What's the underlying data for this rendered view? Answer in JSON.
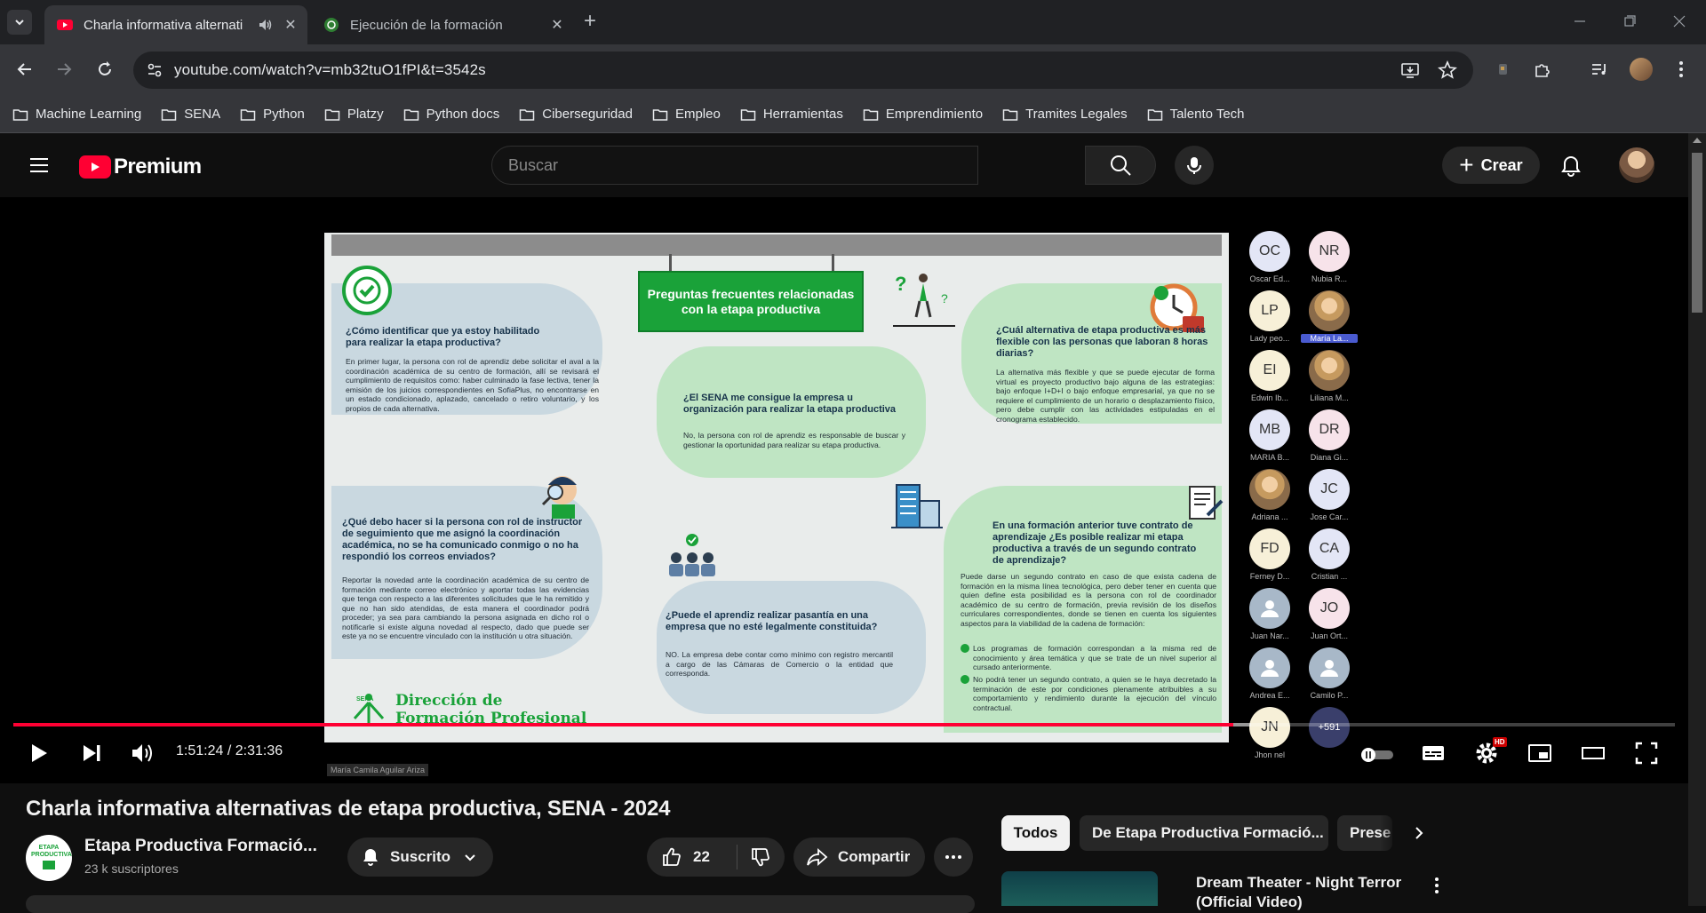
{
  "browser": {
    "tabs": [
      {
        "title": "Charla informativa alternati",
        "active": true
      },
      {
        "title": "Ejecución de la formación",
        "active": false
      }
    ],
    "url": "youtube.com/watch?v=mb32tuO1fPI&t=3542s",
    "bookmarks": [
      "Machine Learning",
      "SENA",
      "Python",
      "Platzy",
      "Python docs",
      "Ciberseguridad",
      "Empleo",
      "Herramientas",
      "Emprendimiento",
      "Tramites Legales",
      "Talento Tech"
    ]
  },
  "youtube": {
    "logo_label": "Premium",
    "search_placeholder": "Buscar",
    "create_label": "Crear"
  },
  "slide": {
    "title": "Preguntas frecuentes relacionadas con la etapa productiva",
    "q1": "¿Cómo identificar que ya estoy habilitado para realizar la etapa productiva?",
    "a1": "En primer lugar, la persona con rol de aprendiz debe solicitar el aval a la coordinación académica de su centro de formación, allí se revisará el cumplimiento de requisitos como: haber culminado la fase lectiva, tener la emisión de los juicios correspondientes en SofiaPlus, no encontrarse en un estado condicionado, aplazado, cancelado o retiro voluntario, y los propios de cada alternativa.",
    "q2": "¿El SENA me consigue la empresa u organización para realizar la etapa productiva",
    "a2": "No, la persona con rol de aprendiz es responsable de buscar y gestionar la oportunidad para realizar su etapa productiva.",
    "q3": "¿Cuál alternativa de etapa productiva es más flexible con las personas que laboran 8 horas diarias?",
    "a3": "La alternativa más flexible y que se puede ejecutar de forma virtual es proyecto productivo bajo alguna de las estrategias: bajo enfoque I+D+I o bajo enfoque empresarial, ya que no se requiere el cumplimiento de un horario o desplazamiento físico, pero debe cumplir con las actividades estipuladas en el cronograma establecido.",
    "q4": "¿Qué debo hacer si la persona con rol de instructor de seguimiento que me asignó la coordinación académica, no se ha comunicado conmigo o no ha respondió los correos enviados?",
    "a4": "Reportar la novedad ante la coordinación académica de su centro de formación mediante correo electrónico y aportar todas las evidencias que tenga con respecto a las diferentes solicitudes que le ha remitido y que no han sido atendidas, de esta manera el coordinador podrá proceder; ya sea para cambiando la persona asignada en dicho rol o notificarle si existe alguna novedad al respecto, dado que puede ser este ya no se encuentre vinculado con la institución u otra situación.",
    "q5": "¿Puede el aprendiz realizar pasantía en una empresa que no esté legalmente constituida?",
    "a5": "NO. La empresa debe contar como mínimo con registro mercantil a cargo de las Cámaras de Comercio o la entidad que corresponda.",
    "q6": "En una formación anterior tuve contrato de aprendizaje ¿Es posible realizar mi etapa productiva a través de un segundo contrato de aprendizaje?",
    "a6": "Puede darse un segundo contrato en caso de que exista cadena de formación en la misma línea tecnológica, pero deber tener en cuenta que quien define esta posibilidad es la persona con rol de coordinador académico de su centro de formación, previa revisión de los diseños curriculares correspondientes, donde se tienen en cuenta los siguientes aspectos para la viabilidad de la cadena de formación:",
    "a6_b1": "Los programas de formación correspondan a la misma red de conocimiento y área temática y que se trate de un nivel superior al cursado anteriormente.",
    "a6_b2": "No podrá tener un segundo contrato, a quien se le haya decretado la terminación de este por condiciones plenamente atribuibles a su comportamiento y rendimiento durante la ejecución del vínculo contractual.",
    "brand_line1": "Dirección de",
    "brand_line2": "Formación Profesional",
    "brand_logo": "SENA"
  },
  "participants": [
    {
      "initials": "OC",
      "name": "Oscar Ed...",
      "color": "#e3e6f6"
    },
    {
      "initials": "NR",
      "name": "Nubia R...",
      "color": "#f7e3ea"
    },
    {
      "initials": "LP",
      "name": "Lady peo...",
      "color": "#f7f0d8"
    },
    {
      "initials": "",
      "name": "María La...",
      "color": "",
      "photo": true,
      "highlight": true
    },
    {
      "initials": "EI",
      "name": "Edwin Ib...",
      "color": "#f7f0d8"
    },
    {
      "initials": "",
      "name": "Liliana M...",
      "color": "",
      "photo": true
    },
    {
      "initials": "MB",
      "name": "MARIA B...",
      "color": "#e3e6f6"
    },
    {
      "initials": "DR",
      "name": "Diana Gi...",
      "color": "#f7e3ea"
    },
    {
      "initials": "",
      "name": "Adriana ...",
      "color": "",
      "photo": true
    },
    {
      "initials": "JC",
      "name": "Jose Car...",
      "color": "#e3e6f6"
    },
    {
      "initials": "FD",
      "name": "Ferney D...",
      "color": "#f7f0d8"
    },
    {
      "initials": "CA",
      "name": "Cristian ...",
      "color": "#e3e6f6"
    },
    {
      "initials": "",
      "name": "Juan Nar...",
      "color": "#a8b8c8",
      "generic": true
    },
    {
      "initials": "JO",
      "name": "Juan Ort...",
      "color": "#f7e3ea"
    },
    {
      "initials": "",
      "name": "Andrea E...",
      "color": "#a8b8c8",
      "generic": true
    },
    {
      "initials": "",
      "name": "Camilo P...",
      "color": "#a8b8c8",
      "generic": true
    },
    {
      "initials": "JN",
      "name": "Jhon nel",
      "color": "#f7f0d8"
    },
    {
      "initials": "+591",
      "name": "",
      "color": "#3a3f6b",
      "more": true
    }
  ],
  "speaker_name": "María Camila Aguilar Ariza",
  "player": {
    "time_current": "1:51:24",
    "time_separator": "/",
    "time_total": "2:31:36",
    "progress_fraction": 0.734,
    "buffered_fraction": 0.745,
    "hd_badge": "HD"
  },
  "video": {
    "title": "Charla informativa alternativas de etapa productiva, SENA - 2024",
    "channel_name": "Etapa Productiva Formació...",
    "subscribers": "23 k suscriptores",
    "channel_avatar_text": "ETAPA PRODUCTIVA",
    "subscribed_label": "Suscrito",
    "likes": "22",
    "share_label": "Compartir"
  },
  "chips": [
    "Todos",
    "De Etapa Productiva Formació...",
    "Prese"
  ],
  "recommendation": {
    "title": "Dream Theater - Night Terror (Official Video)"
  },
  "colors": {
    "youtube_red": "#ff0033",
    "sena_green": "#1aa239"
  }
}
